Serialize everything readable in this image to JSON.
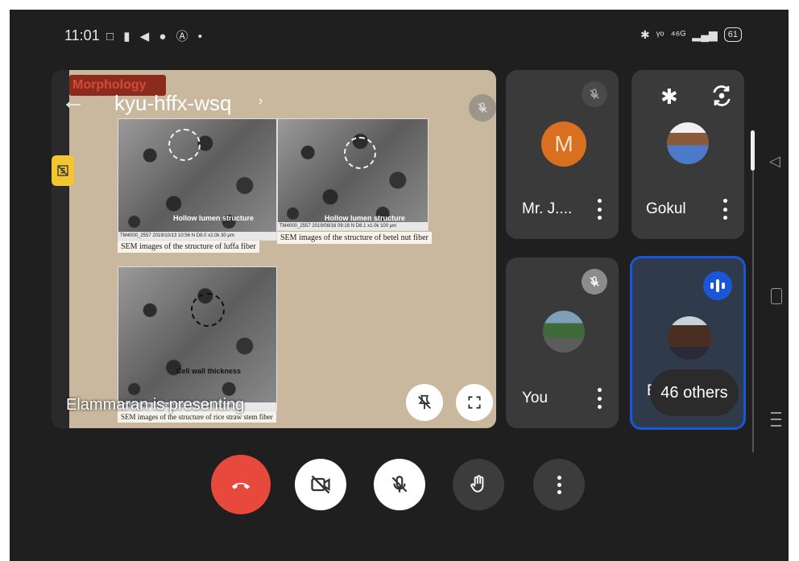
{
  "status_bar": {
    "time": "11:01",
    "left_icons": "□ ▮ ◀ ● Ⓐ •",
    "right_icons": [
      "✱",
      "ᵞᵒ",
      "⁴⁶ᴳ",
      "▂▄▆"
    ],
    "battery": "61"
  },
  "meeting": {
    "code": "kyu-hffx-wsq",
    "presenting_text": "Elammaran is presenting"
  },
  "slide": {
    "title": "Morphology",
    "images": [
      {
        "label": "Hollow lumen structure",
        "caption": "SEM images of the structure of luffa fiber",
        "meta": "TM4000_2557    2019/10/13  10:56 N   D8.0  x2.0k   30 µm"
      },
      {
        "label": "Hollow lumen structure",
        "caption": "SEM images of the structure of betel nut fiber",
        "meta": "TM4000_2557   2019/08/16  09:18 N   D8.1 x1.0k   100 µm"
      },
      {
        "label": "Cell wall thickness",
        "caption": "SEM images of the structure of rice straw stem fiber",
        "meta": "TM4000_0608   2019/08/16  10:43 N   D8.1 x2.5k   30 µm"
      }
    ]
  },
  "participants": [
    {
      "name": "Mr. J....",
      "initial": "M",
      "muted": true
    },
    {
      "name": "Gokul",
      "muted": false
    },
    {
      "name": "You",
      "muted": true
    },
    {
      "name": "El",
      "others": "46 others",
      "speaking": true
    }
  ],
  "colors": {
    "end_call": "#e74a3d",
    "speaking_blue": "#1a56d8",
    "avatar_orange": "#d9701f",
    "badge_yellow": "#f2c531"
  },
  "icons": {
    "back": "arrow-left-icon",
    "bluetooth": "bluetooth-icon",
    "switch_camera": "switch-camera-icon",
    "end_call": "phone-hangup-icon",
    "camera": "camera-off-icon",
    "mic": "mic-off-icon",
    "raise_hand": "hand-icon",
    "more": "more-vertical-icon"
  }
}
